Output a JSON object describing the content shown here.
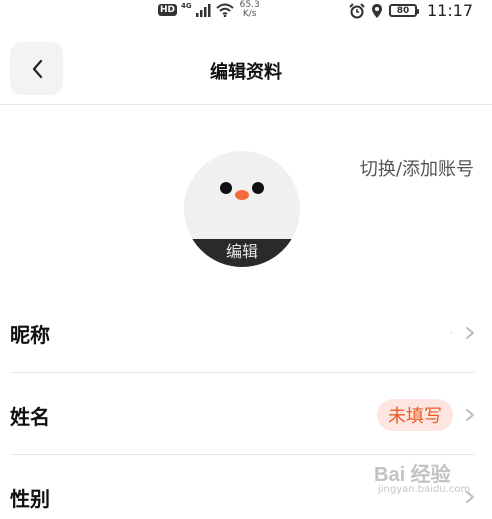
{
  "status_bar": {
    "hd": "HD",
    "net": "4G",
    "speed_value": "65.3",
    "speed_unit": "K/s",
    "battery": "80",
    "time": "11:17"
  },
  "nav": {
    "title": "编辑资料",
    "back_icon": "chevron-left-icon"
  },
  "profile": {
    "switch_account": "切换/添加账号",
    "avatar_edit": "编辑"
  },
  "rows": [
    {
      "label": "昵称",
      "value": "·"
    },
    {
      "label": "姓名",
      "value": "未填写"
    },
    {
      "label": "性别",
      "value": ""
    }
  ],
  "watermark": {
    "logo": "Bai 经验",
    "url": "jingyan.baidu.com"
  },
  "colors": {
    "accent": "#f05a28",
    "badge_bg": "#fde6e0",
    "back_bg": "#f2f3f5"
  }
}
